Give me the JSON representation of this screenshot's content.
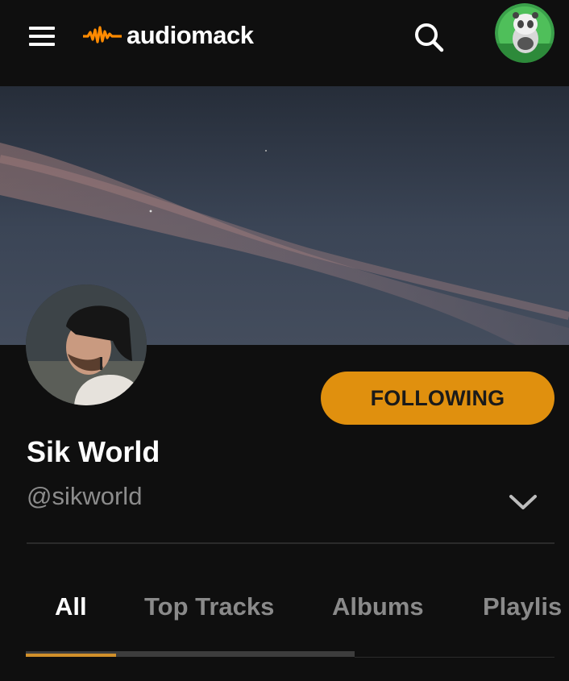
{
  "app": {
    "logo_text": "audiomack",
    "accent_color": "#e0900e"
  },
  "icons": {
    "menu": "hamburger-menu-icon",
    "logo": "waveform-logo-icon",
    "search": "search-icon",
    "expand": "chevron-down-icon"
  },
  "profile": {
    "name": "Sik World",
    "handle": "@sikworld",
    "follow_label": "FOLLOWING"
  },
  "tabs": [
    {
      "label": "All",
      "active": true
    },
    {
      "label": "Top Tracks",
      "active": false
    },
    {
      "label": "Albums",
      "active": false
    },
    {
      "label": "Playlis",
      "active": false
    }
  ]
}
